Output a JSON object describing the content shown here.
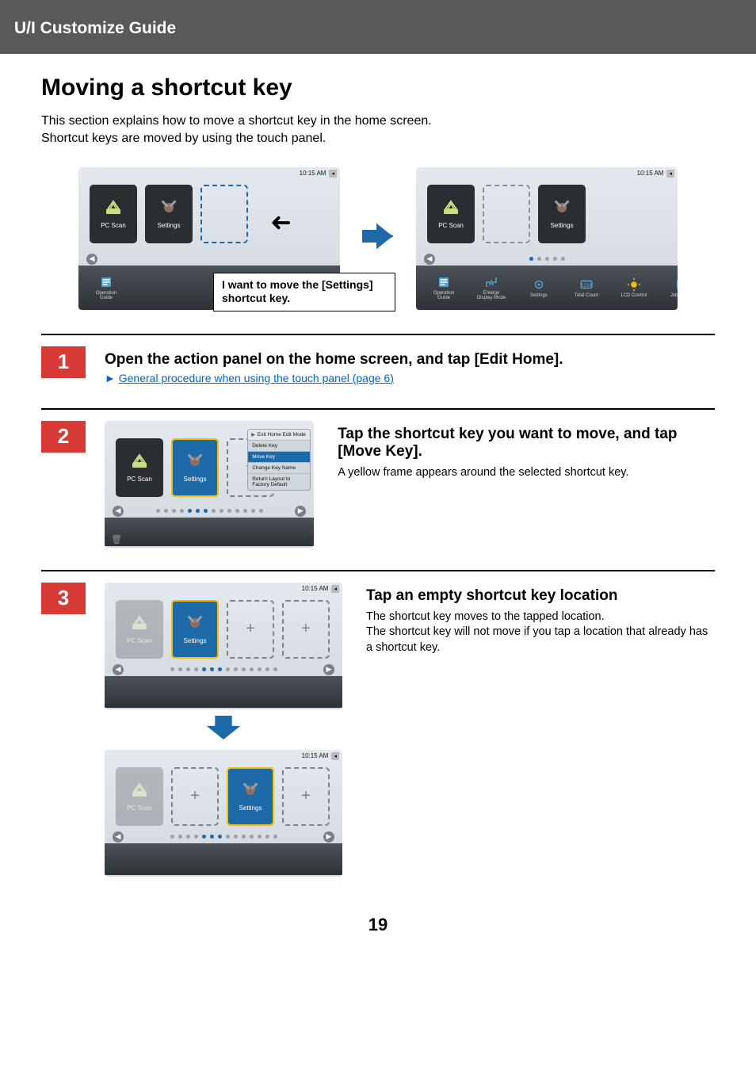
{
  "header": {
    "title": "U/I Customize Guide"
  },
  "page": {
    "title": "Moving a shortcut key",
    "intro_line1": "This section explains how to move a shortcut key in the home screen.",
    "intro_line2": "Shortcut keys are moved by using the touch panel.",
    "number": "19"
  },
  "common": {
    "clock": "10:15 AM",
    "tiles": {
      "pc_scan": "PC Scan",
      "settings": "Settings"
    },
    "bottom_items": {
      "operation_guide": "Operation\nGuide",
      "enlarge": "Enlarge\nDisplay Mode",
      "settings": "Settings",
      "total_count": "Total Count",
      "lcd_control": "LCD Control",
      "job_status": "Job Status"
    }
  },
  "illustration": {
    "callout": "I want to move the [Settings] shortcut key."
  },
  "steps": [
    {
      "num": "1",
      "title": "Open the action panel on the home screen, and tap [Edit Home].",
      "link_text": "General procedure when using the touch panel (page 6)"
    },
    {
      "num": "2",
      "title": "Tap the shortcut key you want to move, and tap [Move Key].",
      "body": "A yellow frame appears around the selected shortcut key.",
      "menu": {
        "head": "Exit Home Edit Mode",
        "delete": "Delete Key",
        "move": "Move Key",
        "change": "Change Key Name",
        "return": "Return Layout to Factory Default"
      }
    },
    {
      "num": "3",
      "title": "Tap an empty shortcut key location",
      "body_line1": "The shortcut key moves to the tapped location.",
      "body_line2": "The shortcut key will not move if you tap a location that already has a shortcut key."
    }
  ]
}
